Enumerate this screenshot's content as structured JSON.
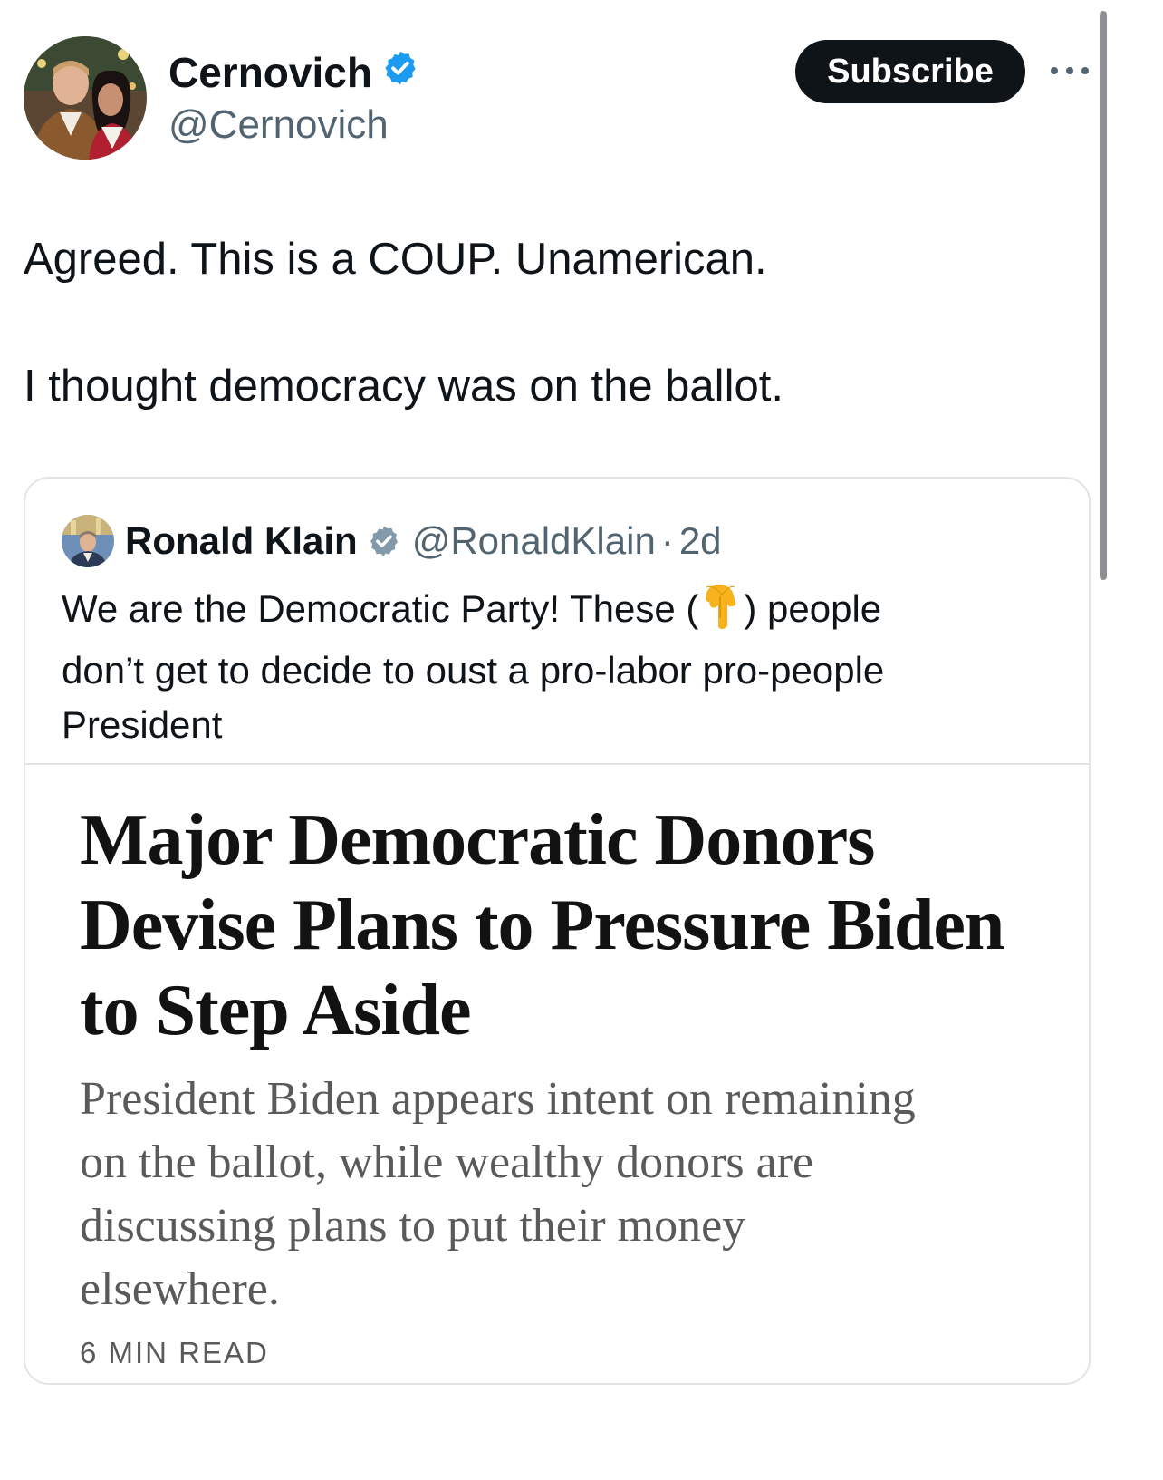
{
  "author": {
    "display_name": "Cernovich",
    "handle": "@Cernovich",
    "verified": true,
    "badge_color": "#1d9bf0"
  },
  "actions": {
    "subscribe_label": "Subscribe",
    "more_icon": "more-horizontal-icon"
  },
  "tweet": {
    "lines": [
      "Agreed. This is a COUP. Unamerican.",
      "I thought democracy was on the ballot."
    ]
  },
  "quoted": {
    "display_name": "Ronald Klain",
    "handle": "@RonaldKlain",
    "separator": "·",
    "time": "2d",
    "badge_color": "#829aab",
    "text_line1_a": "We are the Democratic Party!  These (",
    "text_line1_b": ") people",
    "text_line2": "don’t get to decide to oust a pro-labor pro-people",
    "text_line3": "President",
    "emoji_icon": "pointing-down-hand-icon",
    "article": {
      "headline_lines": [
        "Major Democratic Donors",
        "Devise Plans to Pressure Biden",
        "to Step Aside"
      ],
      "summary_lines": [
        "President Biden appears intent on remaining",
        "on the ballot, while wealthy donors are",
        "discussing plans to put their money",
        "elsewhere."
      ],
      "read_time": "6 MIN READ"
    }
  }
}
